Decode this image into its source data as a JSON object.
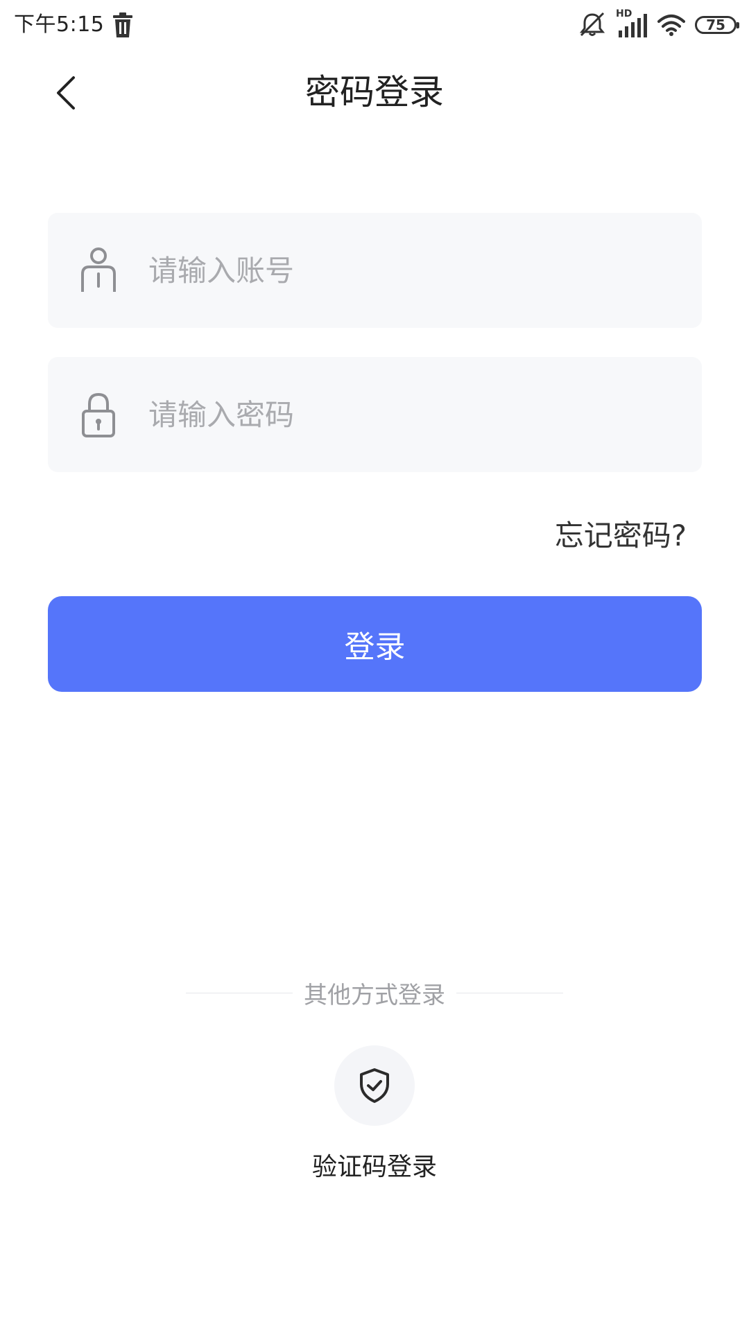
{
  "status_bar": {
    "time": "下午5:15",
    "battery": "75",
    "network_label": "HD",
    "icons": [
      "trash-icon",
      "mute-icon",
      "signal-icon",
      "wifi-icon",
      "battery-icon"
    ]
  },
  "header": {
    "title": "密码登录",
    "back_icon": "chevron-left-icon"
  },
  "form": {
    "account": {
      "placeholder": "请输入账号",
      "value": "",
      "icon": "user-icon"
    },
    "password": {
      "placeholder": "请输入密码",
      "value": "",
      "icon": "lock-icon"
    },
    "forgot_label": "忘记密码?",
    "login_label": "登录"
  },
  "other_methods": {
    "heading": "其他方式登录",
    "items": [
      {
        "label": "验证码登录",
        "icon": "shield-check-icon"
      }
    ]
  },
  "colors": {
    "accent": "#5575fa",
    "field_background": "#f7f8fa",
    "placeholder_text": "#a9aaae",
    "muted_text": "#a0a1a5"
  }
}
